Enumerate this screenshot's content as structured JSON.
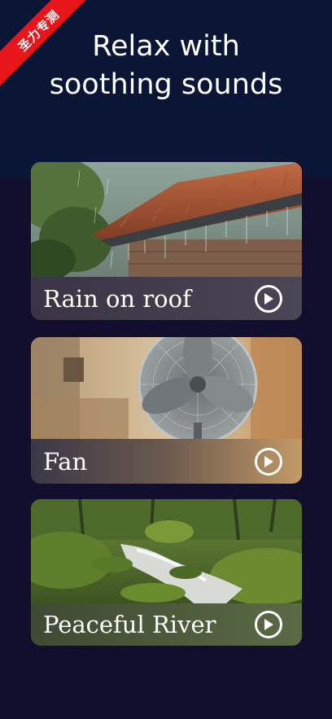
{
  "badge": {
    "text": "圣力专测",
    "color": "#e8151b"
  },
  "header": {
    "title_line1": "Relax with",
    "title_line2": "soothing sounds"
  },
  "cards": [
    {
      "label": "Rain on roof",
      "image": "rain-roof-photo",
      "icon": "play-icon"
    },
    {
      "label": "Fan",
      "image": "fan-photo",
      "icon": "play-icon"
    },
    {
      "label": "Peaceful River",
      "image": "river-photo",
      "icon": "play-icon"
    }
  ],
  "colors": {
    "header_bg": "#0b1535",
    "page_bg": "#120f2e",
    "text": "#ffffff"
  }
}
